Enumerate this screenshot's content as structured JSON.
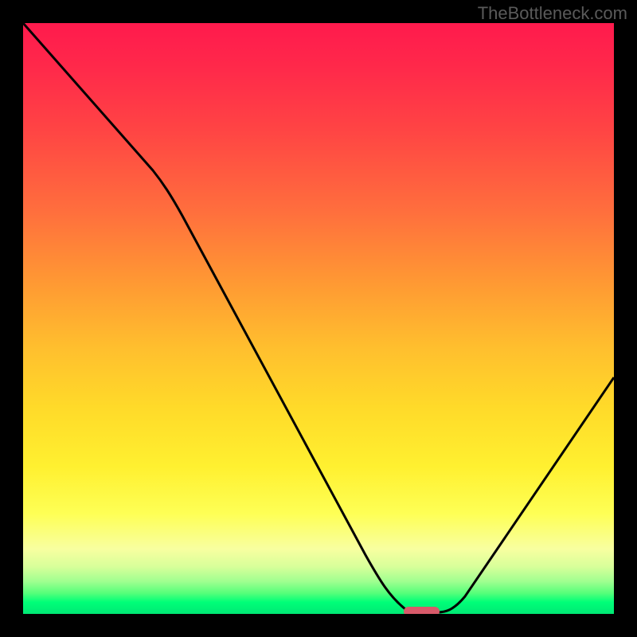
{
  "attribution": "TheBottleneck.com",
  "chart_data": {
    "type": "line",
    "title": "",
    "xlabel": "",
    "ylabel": "",
    "xlim": [
      0,
      100
    ],
    "ylim": [
      0,
      100
    ],
    "x": [
      0,
      8,
      22,
      58,
      65,
      70,
      73,
      100
    ],
    "values": [
      100,
      88,
      75,
      10,
      1,
      0,
      0,
      40
    ],
    "marker": {
      "x_start": 65,
      "x_end": 70,
      "y": 0
    },
    "description": "Bottleneck curve; minimum near x≈67 with green band at bottom and red at top."
  }
}
